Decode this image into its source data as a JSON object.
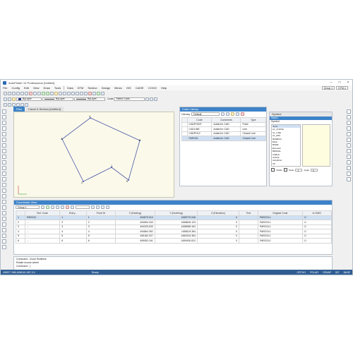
{
  "titlebar": {
    "title": "AutoPlotter 10 Professional [Untitled]"
  },
  "menu": [
    "File",
    "Config",
    "Edit",
    "View",
    "Draw",
    "Tools",
    "Data",
    "DTM",
    "Section",
    "Design",
    "Mines",
    "GIS",
    "CAISE",
    "COGO",
    "Help"
  ],
  "group_select": "Group 1",
  "dtm_select": "DTM-1",
  "toolbar": {
    "layer1": "ByLayer",
    "layer2": "ByLayer",
    "layer3": "ByLayer",
    "code_label": "Code",
    "code_placeholder": "Select Code..."
  },
  "tabs": [
    "Plan",
    "Canal X-Section [Untitled]"
  ],
  "plan_points": [
    {
      "label": "4"
    },
    {
      "label": "3"
    },
    {
      "label": "2"
    },
    {
      "label": "1"
    },
    {
      "label": "6"
    },
    {
      "label": "5"
    }
  ],
  "codes": {
    "header": "Code Library",
    "library_label": "Library",
    "library_value": "Default",
    "columns": [
      "",
      "Code",
      "Comments",
      "Type"
    ],
    "rows": [
      {
        "code": "CADPOINT",
        "comment": "Added in CAD",
        "type": "Point"
      },
      {
        "code": "CADLINE",
        "comment": "Added in CAD",
        "type": "Line"
      },
      {
        "code": "CADPOLY",
        "comment": "Added in CAD",
        "type": "Closed Line"
      },
      {
        "code": "PARCEL",
        "comment": "Added in CAD",
        "type": "Closed Line"
      }
    ]
  },
  "symbol": {
    "header": "Symbol",
    "match_label": "Match",
    "symbol_label": "Symbol",
    "list": [
      "None",
      "AL_CURVE",
      "AL_LINE",
      "AL_MIN",
      "BANBOO",
      "Bank",
      "BORE",
      "Borewell",
      "BRIDGE",
      "CABLE",
      "CANAL",
      "CHURCH",
      "CP"
    ],
    "visible_label": "Visible",
    "scale_label": "Scale",
    "scale_value": "1",
    "angle_label": "Angle",
    "angle_value": "0"
  },
  "coordview": {
    "header": "Coordinate View",
    "group": "Group 1",
    "columns": [
      "",
      "Ref. Code",
      "Entry...",
      "Point ID",
      "X (Easting)",
      "Y (Northing)",
      "Z (Elevation)",
      "Text",
      "Original Code",
      "In DWG"
    ],
    "rows": [
      {
        "idx": "1",
        "ref": "PARCEL",
        "entry": "1",
        "pid": "1",
        "x": "494875.910",
        "y": "1658770.046",
        "z": "0",
        "text": "",
        "orig": "PARCEL1"
      },
      {
        "idx": "2",
        "ref": "...",
        "entry": "2",
        "pid": "2",
        "x": "494554.343",
        "y": "1658626.123",
        "z": "0",
        "text": "",
        "orig": "PARCEL1"
      },
      {
        "idx": "3",
        "ref": "...",
        "entry": "3",
        "pid": "3",
        "x": "494325.533",
        "y": "1658085.342",
        "z": "0",
        "text": "",
        "orig": "PARCEL1"
      },
      {
        "idx": "4",
        "ref": "...",
        "entry": "4",
        "pid": "4",
        "x": "494864.352",
        "y": "1658119.354",
        "z": "0",
        "text": "",
        "orig": "PARCEL1"
      },
      {
        "idx": "5",
        "ref": "...",
        "entry": "5",
        "pid": "5",
        "x": "495182.027",
        "y": "1660319.354",
        "z": "0",
        "text": "",
        "orig": "PARCEL1"
      },
      {
        "idx": "6",
        "ref": "...",
        "entry": "6",
        "pid": "6",
        "x": "495052.161",
        "y": "1659430.812",
        "z": "0",
        "text": "",
        "orig": "PARCEL1"
      }
    ]
  },
  "command": {
    "lines": [
      "Command : Zoom Realtime",
      "Rotate mouse wheel",
      "Command : ]"
    ]
  },
  "status": {
    "coords": "495577.068,1658161.087,0.0",
    "ready": "Ready",
    "toggles": [
      "ORTHO",
      "POLAR",
      "OSNAP",
      "BIT",
      "BASE"
    ]
  }
}
